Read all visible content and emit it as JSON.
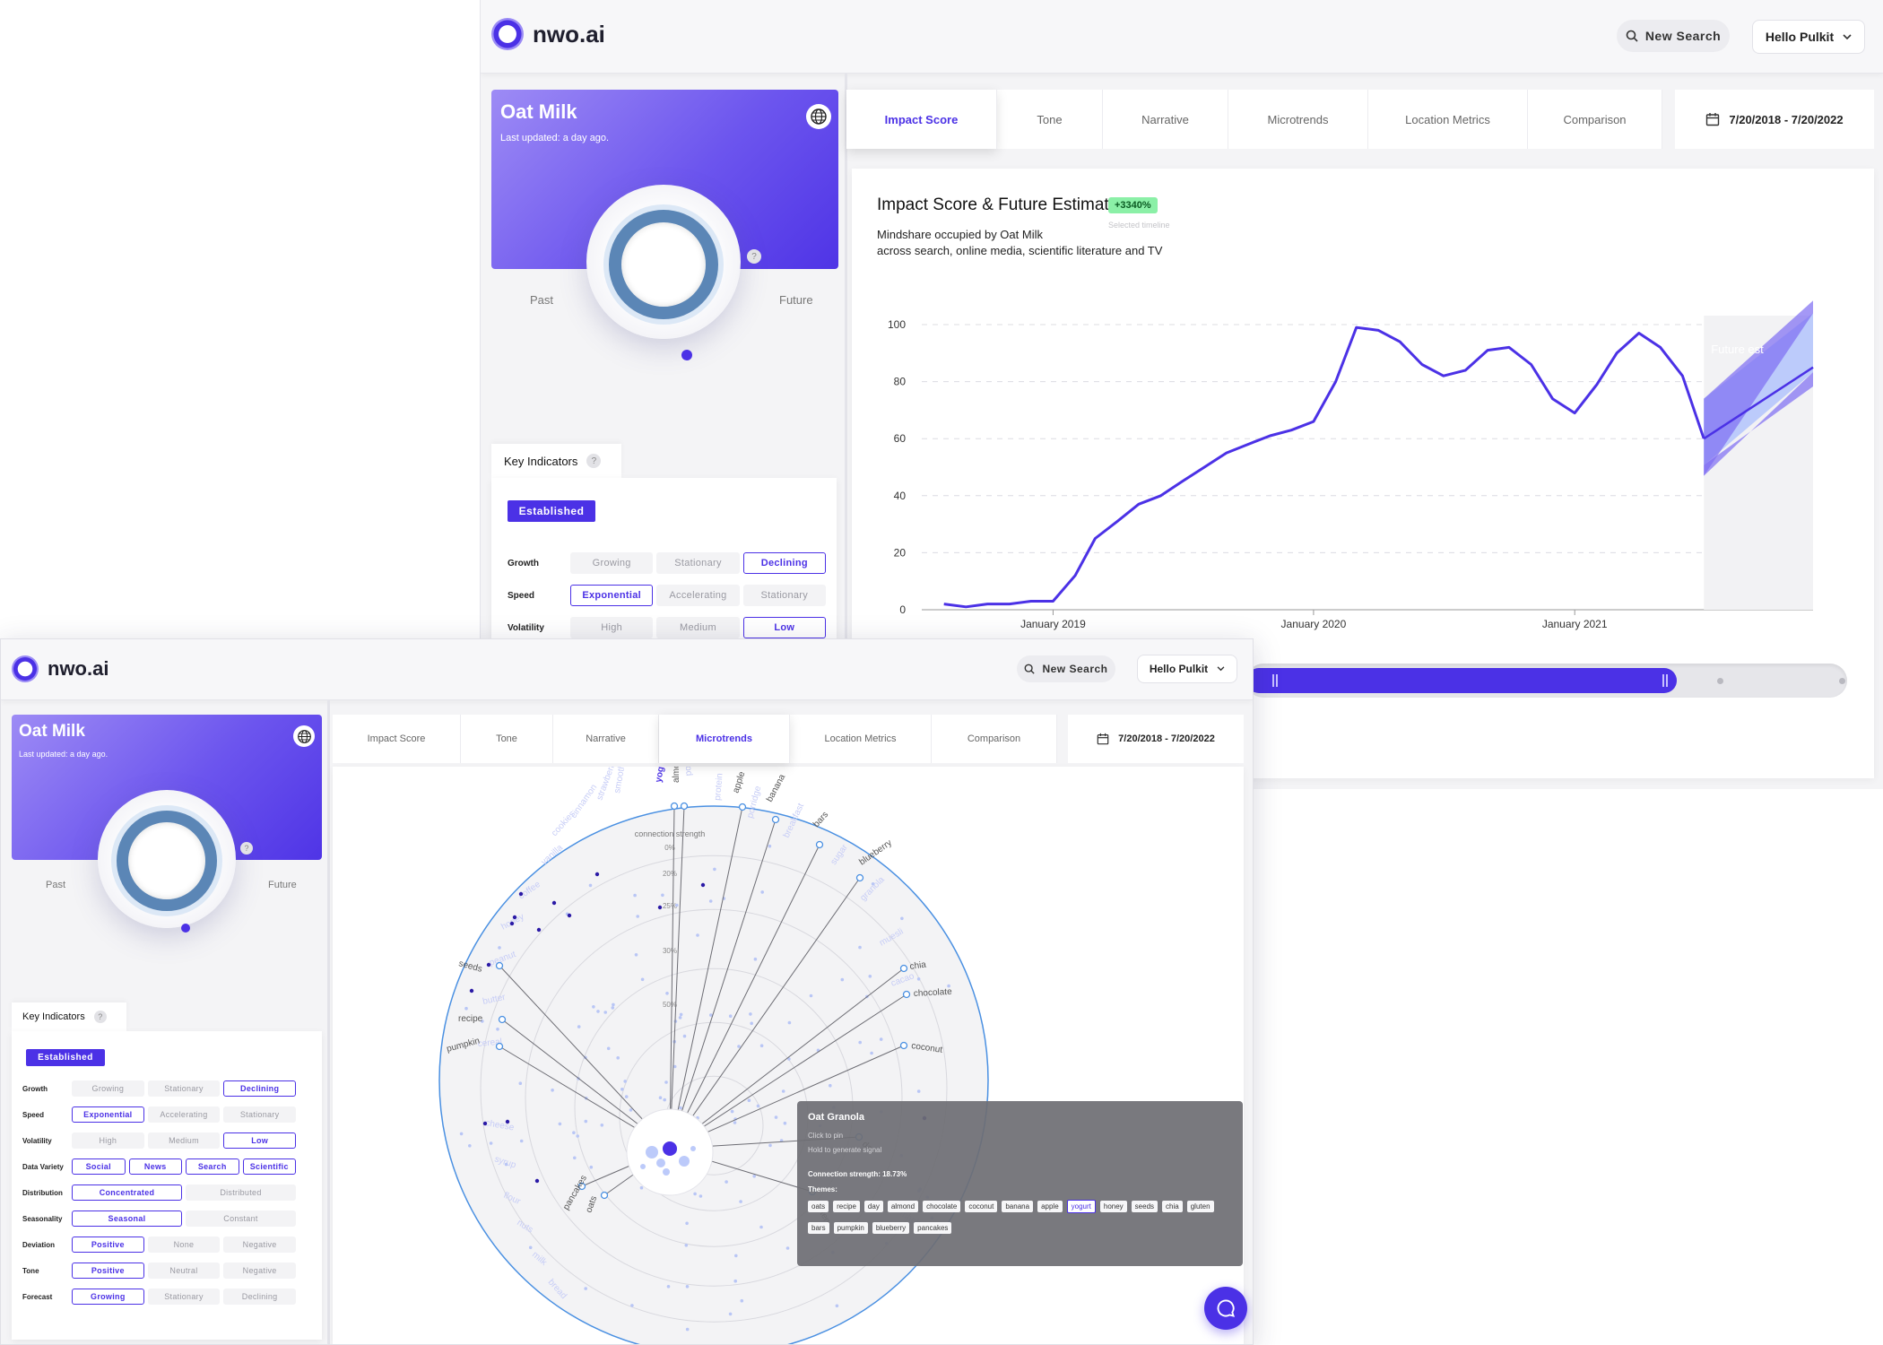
{
  "app": {
    "logo_text": "nwo.ai",
    "new_search": "New Search",
    "greeting": "Hello Pulkit"
  },
  "topic": {
    "title": "Oat Milk",
    "updated": "Last updated: a day ago."
  },
  "gauge": {
    "past": "Past",
    "future": "Future",
    "help": "?"
  },
  "key_indicators": {
    "title": "Key Indicators",
    "help": "?",
    "status": "Established",
    "rows": [
      {
        "label": "Growth",
        "options": [
          "Growing",
          "Stationary",
          "Declining"
        ],
        "selected": [
          2
        ]
      },
      {
        "label": "Speed",
        "options": [
          "Exponential",
          "Accelerating",
          "Stationary"
        ],
        "selected": [
          0
        ]
      },
      {
        "label": "Volatility",
        "options": [
          "High",
          "Medium",
          "Low"
        ],
        "selected": [
          2
        ]
      },
      {
        "label": "Data Variety",
        "options": [
          "Social",
          "News",
          "Search",
          "Scientific"
        ],
        "selected": [
          0,
          1,
          2,
          3
        ]
      },
      {
        "label": "Distribution",
        "options": [
          "Concentrated",
          "Distributed"
        ],
        "selected": [
          0
        ]
      },
      {
        "label": "Seasonality",
        "options": [
          "Seasonal",
          "Constant"
        ],
        "selected": [
          0
        ]
      },
      {
        "label": "Deviation",
        "options": [
          "Positive",
          "None",
          "Negative"
        ],
        "selected": [
          0
        ]
      },
      {
        "label": "Tone",
        "options": [
          "Positive",
          "Neutral",
          "Negative"
        ],
        "selected": [
          0
        ]
      },
      {
        "label": "Forecast",
        "options": [
          "Growing",
          "Stationary",
          "Declining"
        ],
        "selected": [
          0
        ]
      }
    ]
  },
  "tabs": [
    "Impact Score",
    "Tone",
    "Narrative",
    "Microtrends",
    "Location Metrics",
    "Comparison"
  ],
  "window1_active_tab": 0,
  "window2_active_tab": 3,
  "date_range": "7/20/2018 - 7/20/2022",
  "impact": {
    "title": "Impact Score & Future Estimate",
    "help": "?",
    "change_badge": "+3340%",
    "change_caption": "Selected timeline",
    "subtitle_line1": "Mindshare occupied by Oat Milk",
    "subtitle_line2": "across search, online media, scientific literature and TV",
    "future_label": "Future est"
  },
  "chart_data": {
    "type": "line",
    "ylim": [
      0,
      100
    ],
    "y_ticks": [
      0,
      20,
      40,
      60,
      80,
      100
    ],
    "x_ticks": [
      "January 2019",
      "January 2020",
      "January 2021"
    ],
    "grid": "horizontal dashed",
    "series": [
      {
        "x": [
          "2018-08",
          "2018-09",
          "2018-10",
          "2018-11",
          "2018-12",
          "2019-01",
          "2019-02",
          "2019-03",
          "2019-04",
          "2019-05",
          "2019-06",
          "2019-07",
          "2019-08",
          "2019-09",
          "2019-10",
          "2019-11",
          "2019-12",
          "2020-01",
          "2020-02",
          "2020-03",
          "2020-04",
          "2020-05",
          "2020-06",
          "2020-07",
          "2020-08",
          "2020-09",
          "2020-10",
          "2020-11",
          "2020-12",
          "2021-01",
          "2021-02",
          "2021-03",
          "2021-04",
          "2021-05",
          "2021-06",
          "2021-07"
        ],
        "values": [
          2,
          1,
          2,
          2,
          3,
          3,
          12,
          25,
          31,
          37,
          40,
          45,
          50,
          55,
          58,
          61,
          63,
          66,
          80,
          99,
          98,
          94,
          86,
          82,
          84,
          91,
          92,
          86,
          74,
          69,
          79,
          90,
          97,
          92,
          82,
          60
        ]
      }
    ],
    "forecast": {
      "x_start": "2021-07",
      "x_end": "2021-11",
      "value_start": 60,
      "value_end": 85,
      "band_low_start": 52,
      "band_low_end": 72,
      "band_high_start": 74,
      "band_high_end": 104
    }
  },
  "microtrends": {
    "axis_label": "connection strength",
    "rings": [
      "0%",
      "20%",
      "25%",
      "30%",
      "50%"
    ],
    "labels_right": [
      "yogurt",
      "almond",
      "apple",
      "banana",
      "bars",
      "blueberry",
      "chia",
      "chocolate",
      "coconut",
      "day",
      "gluten"
    ],
    "labels_left": [
      "seeds",
      "recipe",
      "pumpkin",
      "pancakes",
      "oats"
    ],
    "faint_labels": [
      "strawberry",
      "cinnamon",
      "cookies",
      "vanilla",
      "coffee",
      "honey",
      "peanut",
      "butter",
      "cereal",
      "cheese",
      "syrup",
      "flour",
      "nuts",
      "milk",
      "bread",
      "smoothie",
      "powder",
      "protein",
      "porridge",
      "breakfast",
      "sugar",
      "granola",
      "muesli",
      "cacao",
      "maple"
    ]
  },
  "tooltip": {
    "title": "Oat Granola",
    "hint1": "Click to pin",
    "hint2": "Hold to generate signal",
    "strength": "Connection strength: 18.73%",
    "themes_label": "Themes:",
    "themes": [
      "oats",
      "recipe",
      "day",
      "almond",
      "chocolate",
      "coconut",
      "banana",
      "apple",
      "yogurt",
      "honey",
      "seeds",
      "chia",
      "gluten",
      "bars",
      "pumpkin",
      "blueberry",
      "pancakes"
    ],
    "selected_theme": "yogurt"
  },
  "colors": {
    "accent": "#4b31e6",
    "ring": "#5b86b6",
    "band_dark": "#7d6cf2",
    "band_light": "#b8c8fb",
    "radar_stroke": "#4a90e2"
  }
}
